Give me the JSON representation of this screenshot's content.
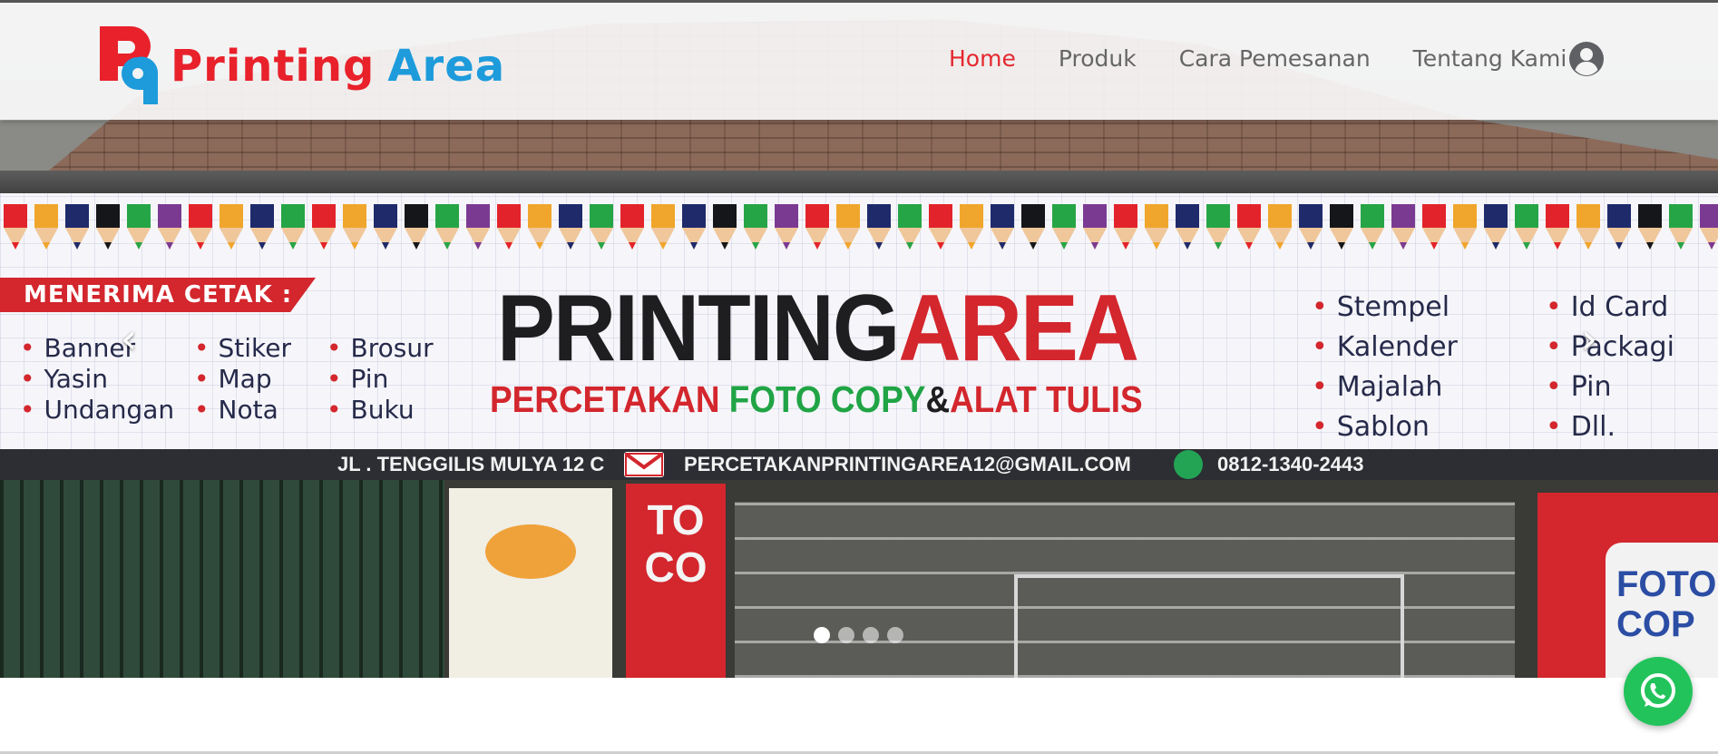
{
  "brand": {
    "word1": "Printing",
    "word2": "Area",
    "mark": "Pq"
  },
  "nav": {
    "items": [
      {
        "label": "Home",
        "active": true
      },
      {
        "label": "Produk",
        "active": false
      },
      {
        "label": "Cara Pemesanan",
        "active": false
      },
      {
        "label": "Tentang Kami",
        "active": false
      }
    ]
  },
  "hero": {
    "banner": {
      "menerima": "MENERIMA CETAK :",
      "col1": [
        "Banner",
        "Yasin",
        "Undangan"
      ],
      "col2": [
        "Stiker",
        "Map",
        "Nota"
      ],
      "col3": [
        "Brosur",
        "Pin",
        "Buku"
      ],
      "col4": [
        "Stempel",
        "Kalender",
        "Majalah",
        "Sablon"
      ],
      "col5": [
        "Id Card",
        "Packagi",
        "Pin",
        "Dll."
      ],
      "brand_dark": "PRINTING",
      "brand_red": "AREA",
      "tag1": "PERCETAKAN",
      "tag2": "FOTO COPY",
      "tag_amp": "&",
      "tag3": "ALAT TULIS",
      "address": "JL . TENGGILIS MULYA 12 C",
      "email": "PERCETAKANPRINTINGAREA12@GMAIL.COM",
      "phone": "0812-1340-2443"
    },
    "shop_sign": "TO\nCO",
    "right_sign": "FOTO\nCOP",
    "prev_arrow": "‹",
    "next_arrow": "›",
    "slide_count": 4,
    "active_slide": 0
  },
  "colors": {
    "accent": "#e5282f",
    "brand_blue": "#1d9bdb",
    "whatsapp": "#22c35b"
  },
  "icons": {
    "user": "user-circle-icon",
    "whatsapp": "whatsapp-icon"
  }
}
